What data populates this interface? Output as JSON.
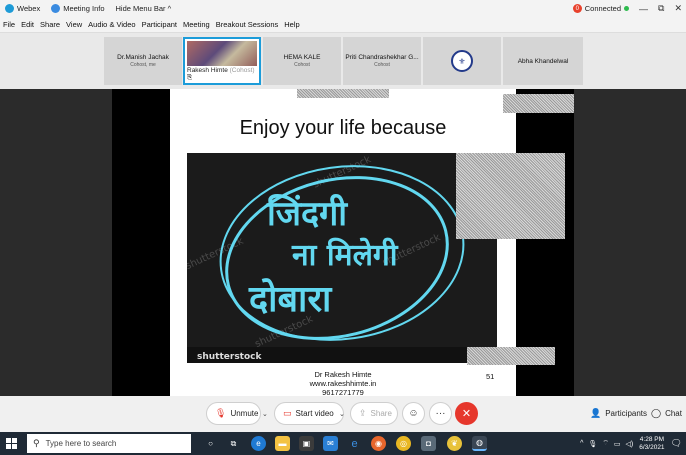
{
  "titlebar": {
    "app": "Webex",
    "meeting_info": "Meeting Info",
    "hide_menu_bar": "Hide Menu Bar ^",
    "connected_count": "0",
    "status": "Connected",
    "controls": [
      "—",
      "⧉",
      "✕"
    ]
  },
  "menubar": {
    "items": [
      "File",
      "Edit",
      "Share",
      "View",
      "Audio & Video",
      "Participant",
      "Meeting",
      "Breakout Sessions",
      "Help"
    ]
  },
  "participants": [
    {
      "name": "Dr.Manish Jachak",
      "role": "Cohost, me"
    },
    {
      "name": "Rakesh Himte",
      "role": "(Cohost)",
      "active": true
    },
    {
      "name": "HEMA KALE",
      "role": "Cohost"
    },
    {
      "name": "Priti Chandrashekhar G...",
      "role": "Cohost"
    },
    {
      "name": "",
      "role": "",
      "logo": true
    },
    {
      "name": "Abha Khandelwal",
      "role": ""
    }
  ],
  "slide": {
    "title": "Enjoy your life because",
    "image_lines": [
      "जिंदगी",
      "ना मिलेगी",
      "दोबारा"
    ],
    "watermark": "shutterstock",
    "footer": [
      "Dr Rakesh Himte",
      "www.rakeshhimte.in",
      "9617271779"
    ],
    "page_number": "51"
  },
  "controls": {
    "unmute": "Unmute",
    "start_video": "Start video",
    "share": "Share",
    "more": "···",
    "end": "✕",
    "participants": "Participants",
    "chat": "Chat"
  },
  "taskbar": {
    "search_placeholder": "Type here to search",
    "time": "4:28 PM",
    "date": "6/3/2021"
  },
  "colors": {
    "accent": "#1c9cd9",
    "end_red": "#e6372c",
    "brush_cyan": "#62d8f0"
  }
}
